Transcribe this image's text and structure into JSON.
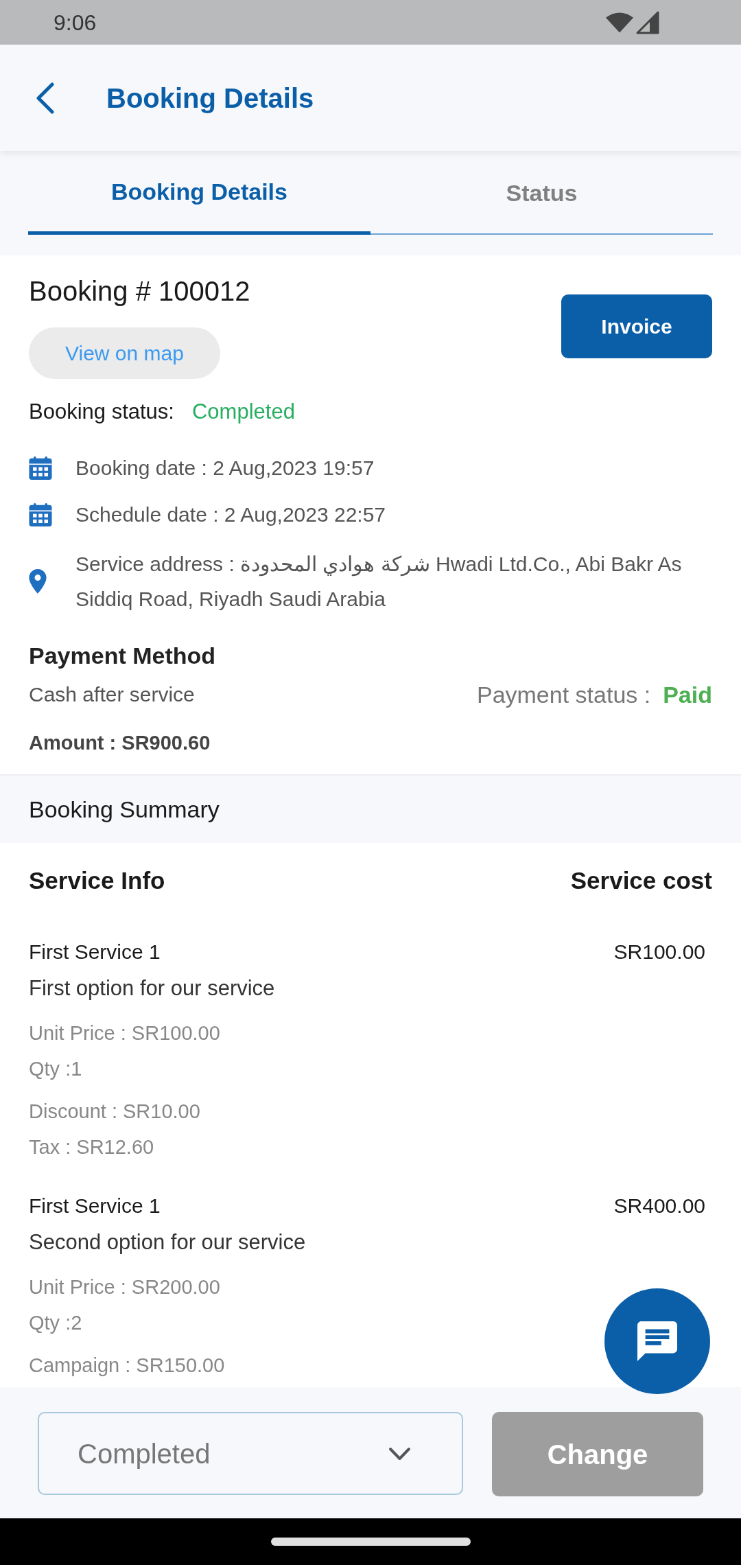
{
  "status_bar": {
    "time": "9:06"
  },
  "app_bar": {
    "title": "Booking Details"
  },
  "tabs": [
    {
      "label": "Booking Details",
      "selected": true
    },
    {
      "label": "Status",
      "selected": false
    }
  ],
  "booking": {
    "number": "Booking # 100012",
    "map_link": "View on map",
    "invoice_button": "Invoice",
    "status_label": "Booking status:",
    "status_value": "Completed",
    "details": [
      {
        "kind": "calendar",
        "text": "Booking date : 2 Aug,2023 19:57"
      },
      {
        "kind": "calendar",
        "text": "Schedule date : 2 Aug,2023 22:57"
      },
      {
        "kind": "location",
        "text": "Service address : شركة هوادي المحدودة Hwadi Ltd.Co., Abi Bakr As Siddiq Road, Riyadh Saudi Arabia"
      }
    ]
  },
  "payment": {
    "title": "Payment Method",
    "method": "Cash after service",
    "status_label": "Payment status :",
    "status_value": "Paid",
    "amount": "Amount : SR900.60"
  },
  "summary": {
    "title": "Booking Summary",
    "columns": [
      "Service Info",
      "Service cost"
    ],
    "items": [
      {
        "name": "First Service 1",
        "option": "First option for our service",
        "cost": "SR100.00",
        "line_groups": [
          [
            "Unit Price : SR100.00",
            "Qty :1"
          ],
          [
            "Discount : SR10.00",
            "Tax : SR12.60"
          ]
        ]
      },
      {
        "name": "First Service 1",
        "option": "Second option for our service",
        "cost": "SR400.00",
        "line_groups": [
          [
            "Unit Price : SR200.00",
            "Qty :2"
          ],
          [
            "Campaign : SR150.00"
          ]
        ]
      }
    ]
  },
  "bottom_bar": {
    "status_dropdown": {
      "value": "Completed"
    },
    "change_button": {
      "label": "Change",
      "disabled": true
    }
  }
}
